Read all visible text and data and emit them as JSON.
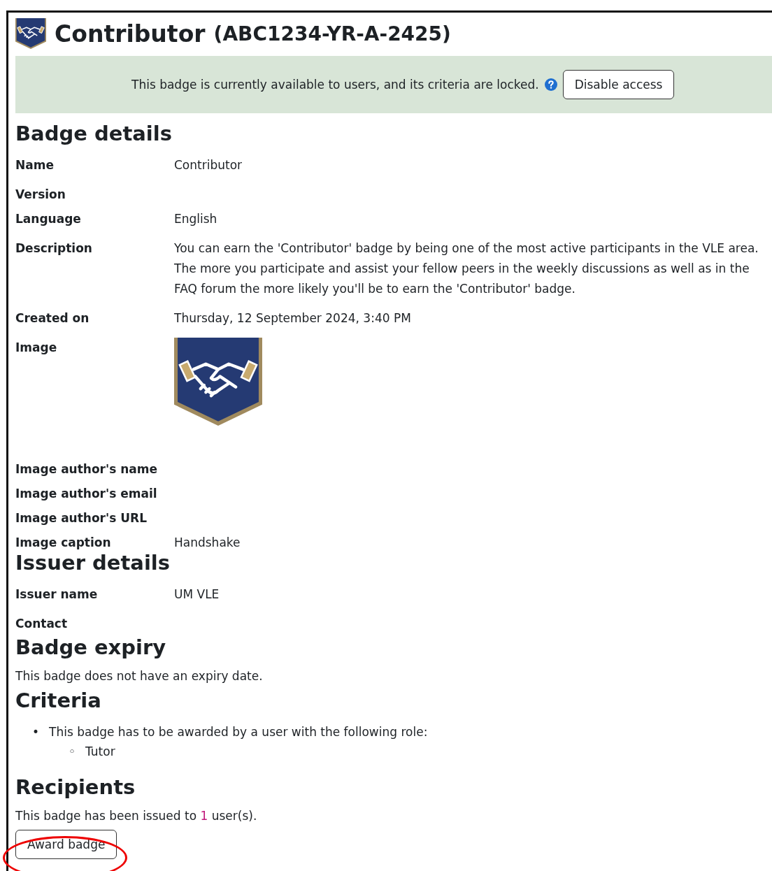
{
  "header": {
    "title": "Contributor",
    "code": "(ABC1234-YR-A-2425)"
  },
  "notice": {
    "text": "This badge is currently available to users, and its criteria are locked.",
    "button": "Disable access"
  },
  "badge_details": {
    "heading": "Badge details",
    "rows": [
      {
        "label": "Name",
        "kind": "text",
        "value": "Contributor"
      },
      {
        "label": "Version",
        "kind": "empty"
      },
      {
        "label": "Language",
        "kind": "text",
        "value": "English"
      },
      {
        "label": "Description",
        "kind": "text",
        "value": "You can earn the 'Contributor' badge by being one of the most active participants in the VLE area. The more you participate and assist your fellow peers in the weekly discussions as well as in the FAQ forum the more likely you'll be to earn the 'Contributor' badge."
      },
      {
        "label": "Created on",
        "kind": "text",
        "value": "Thursday, 12 September 2024, 3:40 PM"
      },
      {
        "label": "Image",
        "kind": "image"
      },
      {
        "label": "Image author's name",
        "kind": "empty"
      },
      {
        "label": "Image author's email",
        "kind": "empty"
      },
      {
        "label": "Image author's URL",
        "kind": "empty"
      },
      {
        "label": "Image caption",
        "kind": "text",
        "value": "Handshake"
      }
    ]
  },
  "issuer_details": {
    "heading": "Issuer details",
    "rows": [
      {
        "label": "Issuer name",
        "kind": "text",
        "value": "UM VLE"
      },
      {
        "label": "Contact",
        "kind": "empty"
      }
    ]
  },
  "badge_expiry": {
    "heading": "Badge expiry",
    "text": "This badge does not have an expiry date."
  },
  "criteria": {
    "heading": "Criteria",
    "items": [
      {
        "marker": "•",
        "text": "This badge has to be awarded by a user with the following role:",
        "children": [
          {
            "marker": "◦",
            "text": "Tutor"
          }
        ]
      }
    ]
  },
  "recipients": {
    "heading": "Recipients",
    "text_before": "This badge has been issued to",
    "count": "1",
    "text_after": "user(s).",
    "button": "Award badge"
  }
}
